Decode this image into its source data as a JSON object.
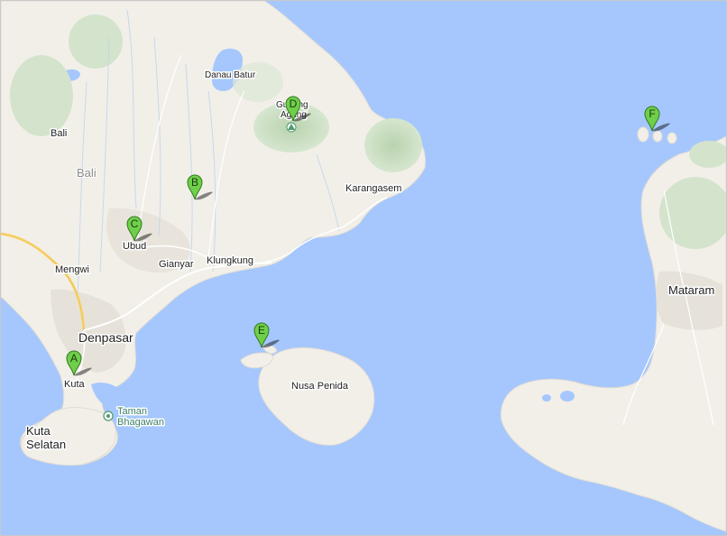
{
  "map": {
    "colors": {
      "water": "#a5c7fd",
      "land": "#f2efe9",
      "park": "#cfe2c8",
      "urban": "#e8e4dc",
      "pin": "#6fcf4a",
      "pin_stroke": "#2f7a1c",
      "road_major": "#f8d673"
    },
    "labels": {
      "danau_batur": "Danau Batur",
      "gunung": "Gunung",
      "agung": "Agung",
      "bali_city": "Bali",
      "bali_region": "Bali",
      "karangasem": "Karangasem",
      "ubud": "Ubud",
      "gianyar": "Gianyar",
      "klungkung": "Klungkung",
      "mengwi": "Mengwi",
      "denpasar": "Denpasar",
      "kuta": "Kuta",
      "kuta_selatan_1": "Kuta",
      "kuta_selatan_2": "Selatan",
      "taman_1": "Taman",
      "taman_2": "Bhagawan",
      "nusa_penida": "Nusa Penida",
      "mataram": "Mataram"
    },
    "markers": [
      {
        "letter": "A"
      },
      {
        "letter": "B"
      },
      {
        "letter": "C"
      },
      {
        "letter": "D"
      },
      {
        "letter": "E"
      },
      {
        "letter": "F"
      }
    ],
    "icons": {
      "poi": "park-poi-icon",
      "peak": "volcano-peak-icon"
    }
  }
}
